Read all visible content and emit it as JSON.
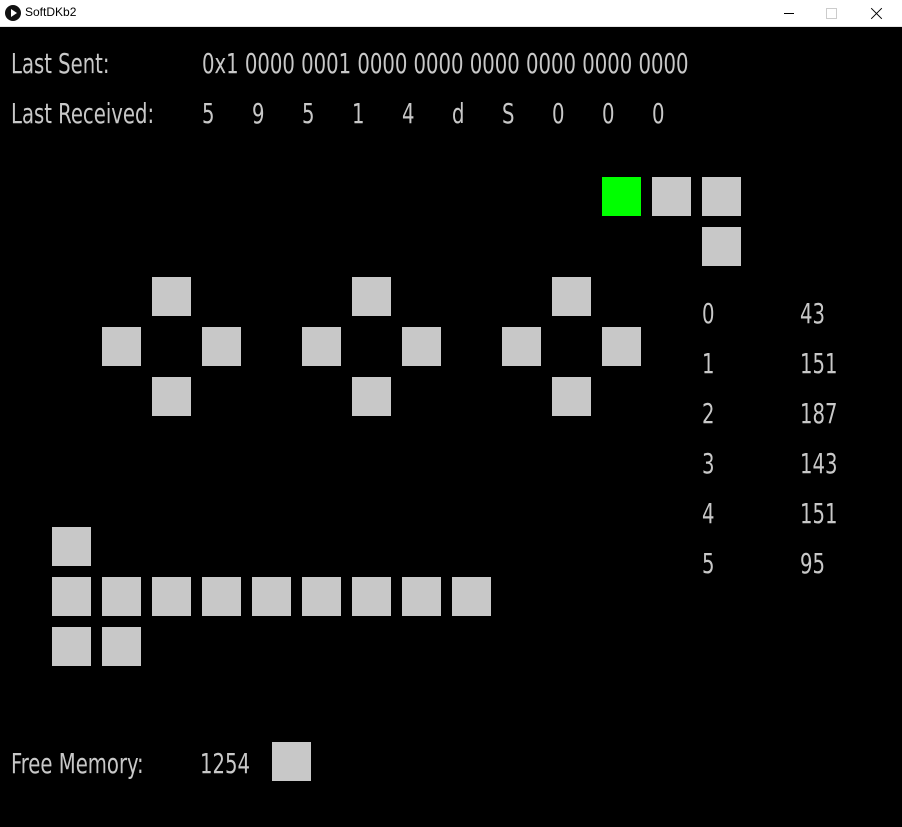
{
  "window": {
    "title": "SoftDKb2"
  },
  "status": {
    "last_sent_label": "Last Sent:",
    "last_sent_value": "0x1 0000 0001 0000 0000 0000 0000 0000 0000",
    "last_received_label": "Last Received:",
    "last_received_values": [
      "5",
      "9",
      "5",
      "1",
      "4",
      "d",
      "S",
      "0",
      "0",
      "0"
    ]
  },
  "readings": [
    {
      "index": "0",
      "value": "43"
    },
    {
      "index": "1",
      "value": "151"
    },
    {
      "index": "2",
      "value": "187"
    },
    {
      "index": "3",
      "value": "143"
    },
    {
      "index": "4",
      "value": "151"
    },
    {
      "index": "5",
      "value": "95"
    }
  ],
  "memory": {
    "label": "Free Memory:",
    "value": "1254"
  },
  "colors": {
    "background": "#000000",
    "foreground": "#c8c8c8",
    "active": "#00ff00",
    "titlebar": "#ffffff"
  }
}
